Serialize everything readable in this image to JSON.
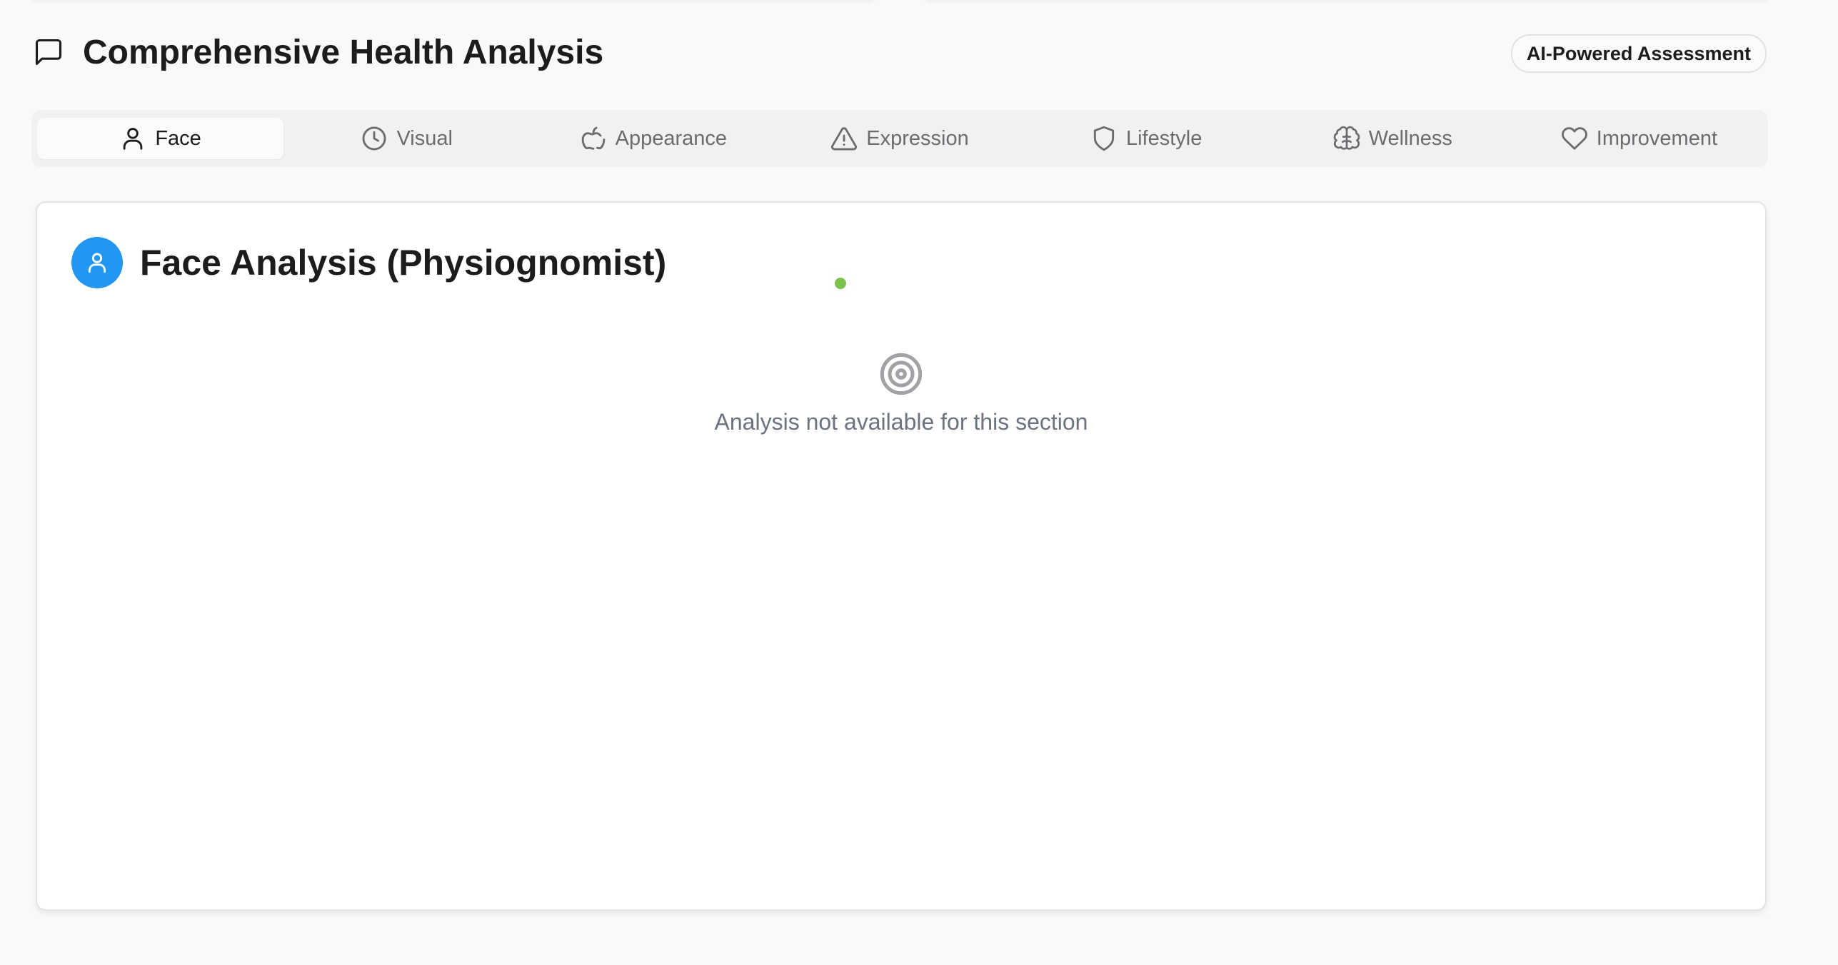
{
  "header": {
    "title": "Comprehensive Health Analysis",
    "icon": "message-square-icon",
    "badge": "AI-Powered Assessment"
  },
  "tabs": [
    {
      "label": "Face",
      "icon": "user-icon",
      "active": true
    },
    {
      "label": "Visual",
      "icon": "clock-icon",
      "active": false
    },
    {
      "label": "Appearance",
      "icon": "apple-icon",
      "active": false
    },
    {
      "label": "Expression",
      "icon": "alert-triangle-icon",
      "active": false
    },
    {
      "label": "Lifestyle",
      "icon": "shield-icon",
      "active": false
    },
    {
      "label": "Wellness",
      "icon": "brain-icon",
      "active": false
    },
    {
      "label": "Improvement",
      "icon": "heart-icon",
      "active": false
    }
  ],
  "section": {
    "title": "Face Analysis (Physiognomist)",
    "avatar_icon": "user-icon",
    "empty_icon": "target-icon",
    "empty_message": "Analysis not available for this section"
  },
  "colors": {
    "accent": "#2196f3",
    "status_dot": "#7bc24a",
    "muted_text": "#6b7280",
    "inactive_tab_text": "#6c6c70"
  }
}
